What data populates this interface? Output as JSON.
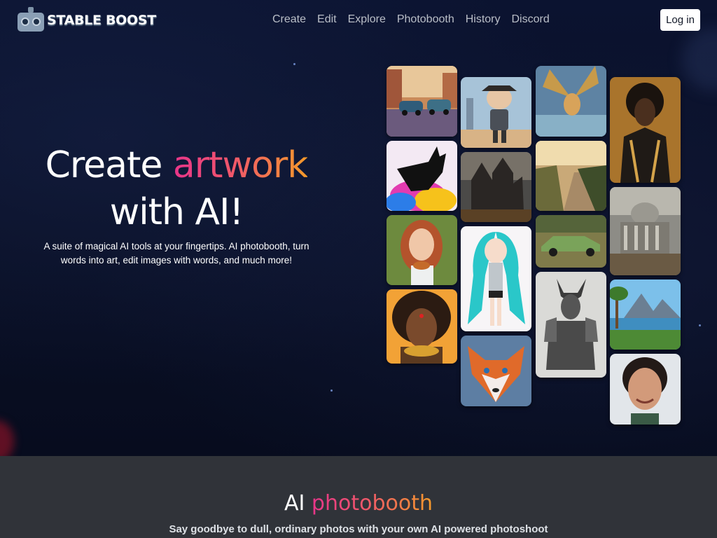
{
  "brand": {
    "name": "STABLE BOOST",
    "icon": "robot-logo-icon"
  },
  "nav": {
    "links": [
      {
        "label": "Create"
      },
      {
        "label": "Edit"
      },
      {
        "label": "Explore"
      },
      {
        "label": "Photobooth"
      },
      {
        "label": "History"
      },
      {
        "label": "Discord"
      }
    ],
    "login_label": "Log in"
  },
  "hero": {
    "title_prefix": "Create ",
    "title_highlight": "artwork",
    "title_line2": "with AI!",
    "description": "A suite of magical AI tools at your fingertips. AI photobooth, turn words into art, edit images with words, and much more!"
  },
  "gallery": [
    {
      "name": "vintage-cars-street-image"
    },
    {
      "name": "black-dog-rainbow-image"
    },
    {
      "name": "redhead-woman-portrait-image"
    },
    {
      "name": "african-queen-portrait-image"
    },
    {
      "name": "robot-boy-character-image"
    },
    {
      "name": "gothic-castle-image"
    },
    {
      "name": "anime-girl-teal-hair-image"
    },
    {
      "name": "fox-portrait-image"
    },
    {
      "name": "winged-dog-flying-image"
    },
    {
      "name": "autumn-road-landscape-image"
    },
    {
      "name": "green-classic-car-image"
    },
    {
      "name": "armored-beast-warrior-image"
    },
    {
      "name": "man-golden-suit-portrait-image"
    },
    {
      "name": "capitol-building-ruins-image"
    },
    {
      "name": "fantasy-lake-landscape-image"
    },
    {
      "name": "smiling-woman-portrait-image"
    }
  ],
  "section2": {
    "title_prefix": "AI ",
    "title_highlight": "photobooth",
    "description": "Say goodbye to dull, ordinary photos with your own AI powered photoshoot"
  },
  "colors": {
    "accent_pink": "#e8358a",
    "accent_orange": "#f59a2a",
    "hero_bg": "#0a1027",
    "section_bg": "#303339"
  }
}
